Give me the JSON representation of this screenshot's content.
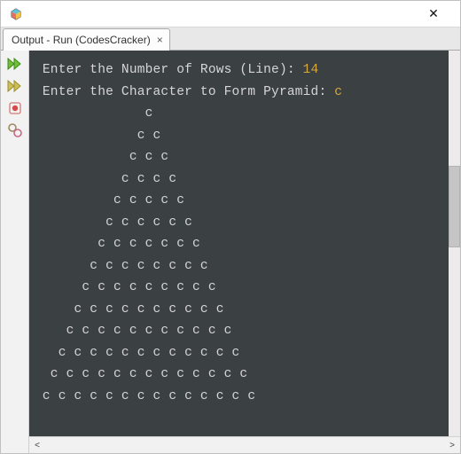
{
  "titlebar": {
    "close_glyph": "✕"
  },
  "tab": {
    "title": "Output - Run (CodesCracker)",
    "close_glyph": "×"
  },
  "toolbar": {
    "icons": [
      "play-all-icon",
      "play-icon",
      "record-icon",
      "settings-icon"
    ]
  },
  "console": {
    "prompt_rows_label": "Enter the Number of Rows (Line): ",
    "rows_value": "14",
    "prompt_char_label": "Enter the Character to Form Pyramid: ",
    "char_value": "c",
    "pyramid_rows": 14,
    "pyramid_char": "c"
  },
  "scroll": {
    "left_glyph": "<",
    "right_glyph": ">"
  },
  "colors": {
    "console_bg": "#3b4043",
    "console_fg": "#d6d6d6",
    "highlight": "#d8a93c"
  }
}
